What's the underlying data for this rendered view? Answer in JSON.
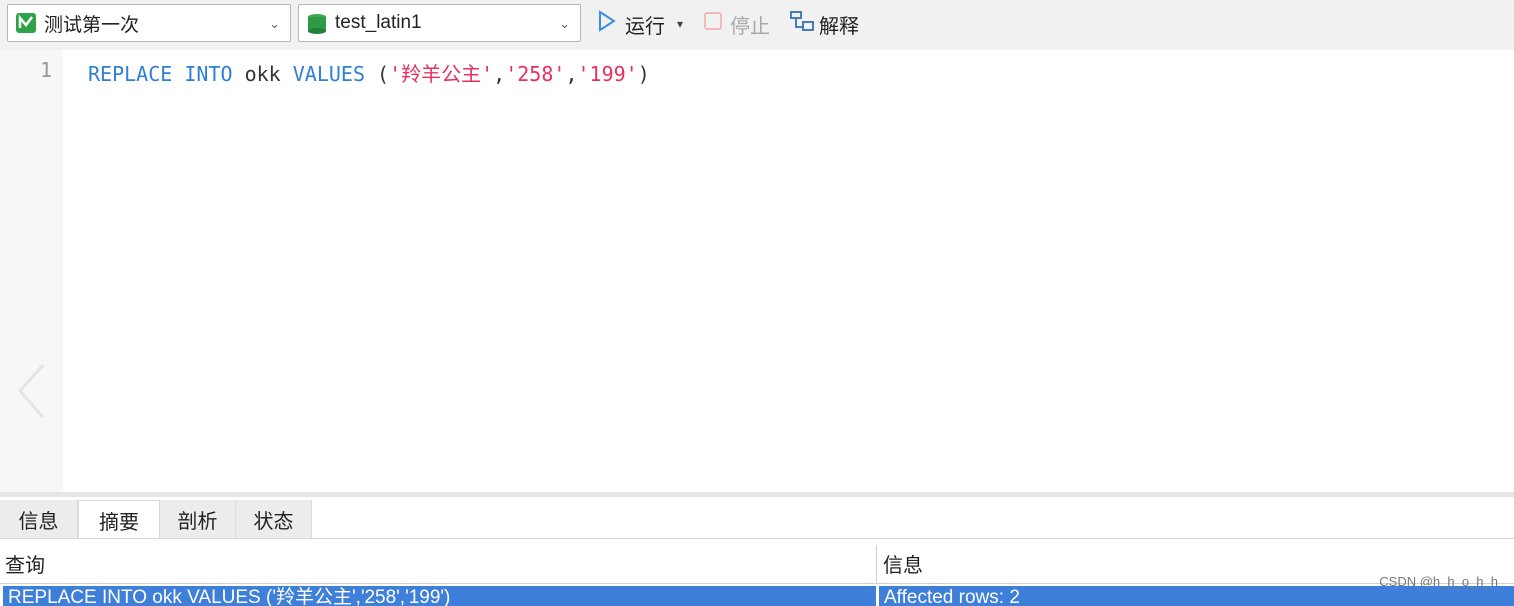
{
  "toolbar": {
    "connection": "测试第一次",
    "database": "test_latin1",
    "run_label": "运行",
    "stop_label": "停止",
    "explain_label": "解释"
  },
  "editor": {
    "line_number": "1",
    "tokens": {
      "kw_replace": "REPLACE",
      "kw_into": "INTO",
      "table": "okk",
      "kw_values": "VALUES",
      "open_paren": "(",
      "val1": "'羚羊公主'",
      "comma1": ",",
      "val2": "'258'",
      "comma2": ",",
      "val3": "'199'",
      "close_paren": ")"
    }
  },
  "result_tabs": [
    "信息",
    "摘要",
    "剖析",
    "状态"
  ],
  "result_table": {
    "headers": [
      "查询",
      "信息"
    ],
    "rows": [
      [
        "REPLACE INTO okk VALUES ('羚羊公主','258','199')",
        "Affected rows: 2"
      ]
    ]
  },
  "watermark": "CSDN @h_h_o_h_h",
  "colors": {
    "keyword": "#2f7fd6",
    "string": "#e8305c",
    "selection": "#3d7fd9"
  },
  "icons": [
    "connection-icon",
    "database-icon",
    "chevron-down-icon",
    "play-icon",
    "stop-icon",
    "explain-icon",
    "chevron-left-icon"
  ]
}
